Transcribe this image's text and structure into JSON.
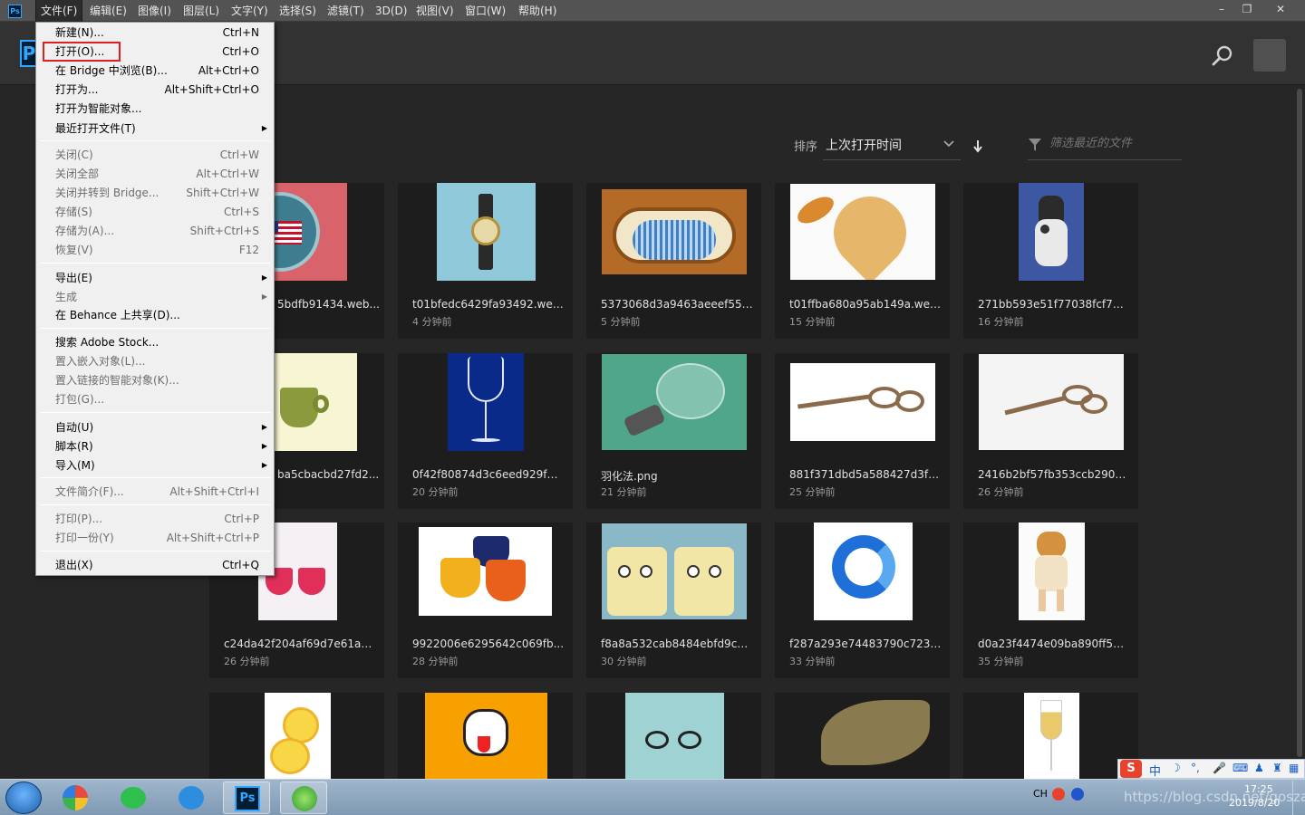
{
  "menubar": {
    "items": [
      "文件(F)",
      "编辑(E)",
      "图像(I)",
      "图层(L)",
      "文字(Y)",
      "选择(S)",
      "滤镜(T)",
      "3D(D)",
      "视图(V)",
      "窗口(W)",
      "帮助(H)"
    ],
    "logo": "Ps"
  },
  "window_controls": {
    "minimize": "–",
    "restore": "❐",
    "close": "✕"
  },
  "header": {
    "logo": "P"
  },
  "sort": {
    "label": "排序",
    "value": "上次打开时间"
  },
  "filter": {
    "placeholder": "筛选最近的文件"
  },
  "file_menu": {
    "items": [
      {
        "label": "新建(N)...",
        "shortcut": "Ctrl+N",
        "disabled": false
      },
      {
        "label": "打开(O)...",
        "shortcut": "Ctrl+O",
        "disabled": false,
        "highlighted": true
      },
      {
        "label": "在 Bridge 中浏览(B)...",
        "shortcut": "Alt+Ctrl+O",
        "disabled": false
      },
      {
        "label": "打开为...",
        "shortcut": "Alt+Shift+Ctrl+O",
        "disabled": false
      },
      {
        "label": "打开为智能对象...",
        "shortcut": "",
        "disabled": false
      },
      {
        "label": "最近打开文件(T)",
        "shortcut": "",
        "disabled": false,
        "submenu": true
      },
      {
        "label": "关闭(C)",
        "shortcut": "Ctrl+W",
        "disabled": true
      },
      {
        "label": "关闭全部",
        "shortcut": "Alt+Ctrl+W",
        "disabled": true
      },
      {
        "label": "关闭并转到 Bridge...",
        "shortcut": "Shift+Ctrl+W",
        "disabled": true
      },
      {
        "label": "存储(S)",
        "shortcut": "Ctrl+S",
        "disabled": true
      },
      {
        "label": "存储为(A)...",
        "shortcut": "Shift+Ctrl+S",
        "disabled": true
      },
      {
        "label": "恢复(V)",
        "shortcut": "F12",
        "disabled": true
      },
      {
        "label": "导出(E)",
        "shortcut": "",
        "disabled": false,
        "submenu": true
      },
      {
        "label": "生成",
        "shortcut": "",
        "disabled": true,
        "submenu": true
      },
      {
        "label": "在 Behance 上共享(D)...",
        "shortcut": "",
        "disabled": false
      },
      {
        "label": "搜索 Adobe Stock...",
        "shortcut": "",
        "disabled": false
      },
      {
        "label": "置入嵌入对象(L)...",
        "shortcut": "",
        "disabled": true
      },
      {
        "label": "置入链接的智能对象(K)...",
        "shortcut": "",
        "disabled": true
      },
      {
        "label": "打包(G)...",
        "shortcut": "",
        "disabled": true
      },
      {
        "label": "自动(U)",
        "shortcut": "",
        "disabled": false,
        "submenu": true
      },
      {
        "label": "脚本(R)",
        "shortcut": "",
        "disabled": false,
        "submenu": true
      },
      {
        "label": "导入(M)",
        "shortcut": "",
        "disabled": false,
        "submenu": true
      },
      {
        "label": "文件简介(F)...",
        "shortcut": "Alt+Shift+Ctrl+I",
        "disabled": true
      },
      {
        "label": "打印(P)...",
        "shortcut": "Ctrl+P",
        "disabled": true
      },
      {
        "label": "打印一份(Y)",
        "shortcut": "Alt+Shift+Ctrl+P",
        "disabled": true
      },
      {
        "label": "退出(X)",
        "shortcut": "Ctrl+Q",
        "disabled": false
      }
    ]
  },
  "recent_files": [
    {
      "name": "5bdfb91434.web...",
      "time": ""
    },
    {
      "name": "t01bfedc6429fa93492.web...",
      "time": "4 分钟前"
    },
    {
      "name": "5373068d3a9463aeeef550...",
      "time": "5 分钟前"
    },
    {
      "name": "t01ffba680a95ab149a.web...",
      "time": "15 分钟前"
    },
    {
      "name": "271bb593e51f77038fcf7019...",
      "time": "16 分钟前"
    },
    {
      "name": "ba5cbacbd27fd2...",
      "time": ""
    },
    {
      "name": "0f42f80874d3c6eed929fde...",
      "time": "20 分钟前"
    },
    {
      "name": "羽化法.png",
      "time": "21 分钟前"
    },
    {
      "name": "881f371dbd5a588427d3fe2...",
      "time": "25 分钟前"
    },
    {
      "name": "2416b2bf57fb353ccb2905e...",
      "time": "26 分钟前"
    },
    {
      "name": "c24da42f204af69d7e61a5b...",
      "time": "26 分钟前"
    },
    {
      "name": "9922006e6295642c069fb...",
      "time": "28 分钟前"
    },
    {
      "name": "f8a8a532cab8484ebfd9cce...",
      "time": "30 分钟前"
    },
    {
      "name": "f287a293e74483790c72324...",
      "time": "33 分钟前"
    },
    {
      "name": "d0a23f4474e09ba890ff5bd...",
      "time": "35 分钟前"
    },
    {
      "name": "",
      "time": ""
    },
    {
      "name": "",
      "time": ""
    },
    {
      "name": "",
      "time": ""
    },
    {
      "name": "",
      "time": ""
    },
    {
      "name": "",
      "time": ""
    }
  ],
  "tray": {
    "lang": "CH",
    "time": "17:25",
    "date": "2019/8/20",
    "watermark": "https://blog.csdn.net/gosza"
  }
}
